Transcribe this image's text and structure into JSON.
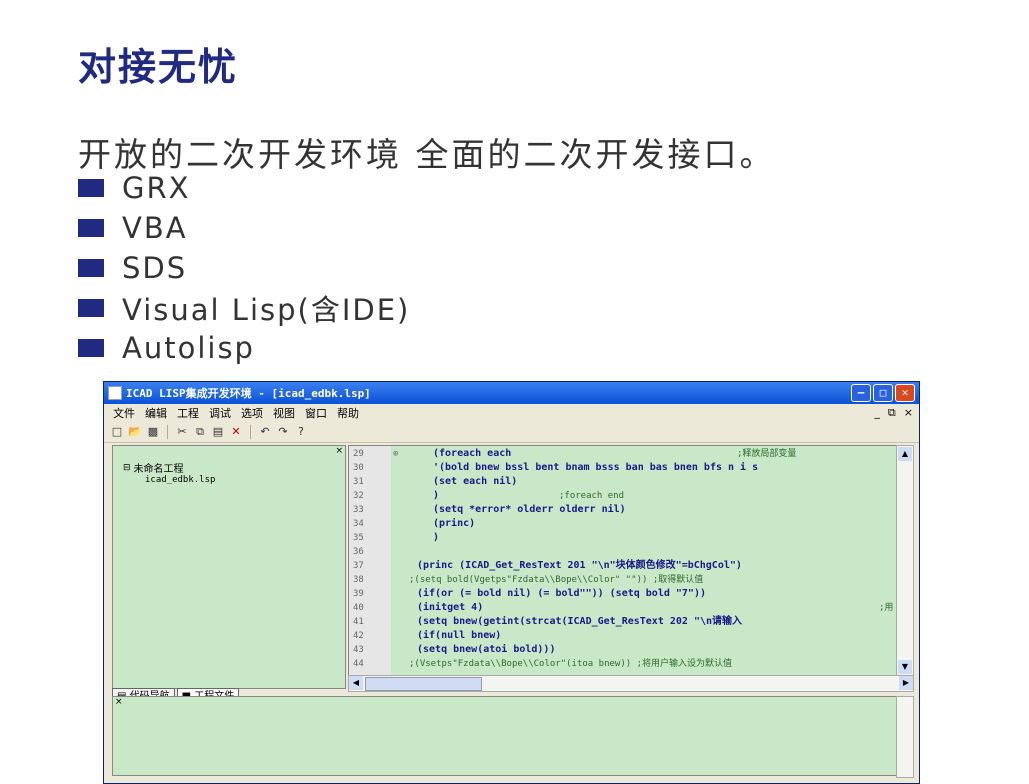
{
  "slide": {
    "title": "对接无忧",
    "subtitle": "开放的二次开发环境 全面的二次开发接口。",
    "bullets": [
      "GRX",
      "VBA",
      "SDS",
      "Visual Lisp(含IDE)",
      "Autolisp"
    ]
  },
  "window": {
    "title": "ICAD LISP集成开发环境 - [icad_edbk.lsp]",
    "menu": [
      "文件",
      "编辑",
      "工程",
      "调试",
      "选项",
      "视图",
      "窗口",
      "帮助"
    ],
    "toolbar_icons": [
      "new-file-icon",
      "open-folder-icon",
      "save-icon",
      "cut-icon",
      "copy-icon",
      "paste-icon",
      "delete-icon",
      "undo-icon",
      "redo-icon",
      "help-icon"
    ],
    "project_tree": {
      "root": "未命名工程",
      "child": "icad_edbk.lsp"
    },
    "tabs": [
      "代码导航",
      "工程文件"
    ],
    "code_lines": [
      {
        "n": "29",
        "code": "(foreach each",
        "comment": ";释放局部变量"
      },
      {
        "n": "30",
        "code": "'(bold bnew bssl bent bnam bsss ban bas bnen bfs n i s",
        "comment": ""
      },
      {
        "n": "31",
        "code": "(set each nil)",
        "comment": ""
      },
      {
        "n": "32",
        "code": ")",
        "comment": ";foreach end"
      },
      {
        "n": "33",
        "code": "(setq *error* olderr olderr nil)",
        "comment": ""
      },
      {
        "n": "34",
        "code": "(princ)",
        "comment": ""
      },
      {
        "n": "35",
        "code": ")",
        "comment": ""
      },
      {
        "n": "36",
        "code": "",
        "comment": ""
      },
      {
        "n": "37",
        "code": "(princ (ICAD_Get_ResText 201 \"\\n\"块体颜色修改\"=bChgCol\")",
        "comment": ""
      },
      {
        "n": "38",
        "code": "",
        "comment": ";(setq bold(Vgetps\"Fzdata\\\\Bope\\\\Color\" \"\"))  ;取得默认值"
      },
      {
        "n": "39",
        "code": "(if(or (= bold nil) (= bold\"\")) (setq bold \"7\"))",
        "comment": ""
      },
      {
        "n": "40",
        "code": "(initget 4)",
        "comment": ";用"
      },
      {
        "n": "41",
        "code": "(setq bnew(getint(strcat(ICAD_Get_ResText 202 \"\\n请输入",
        "comment": ""
      },
      {
        "n": "42",
        "code": "(if(null bnew)",
        "comment": ""
      },
      {
        "n": "43",
        "code": " (setq bnew(atoi bold)))",
        "comment": ""
      },
      {
        "n": "44",
        "code": "",
        "comment": ";(Vsetps\"Fzdata\\\\Bope\\\\Color\"(itoa bnew))    ;将用户输入设为默认值"
      }
    ]
  }
}
